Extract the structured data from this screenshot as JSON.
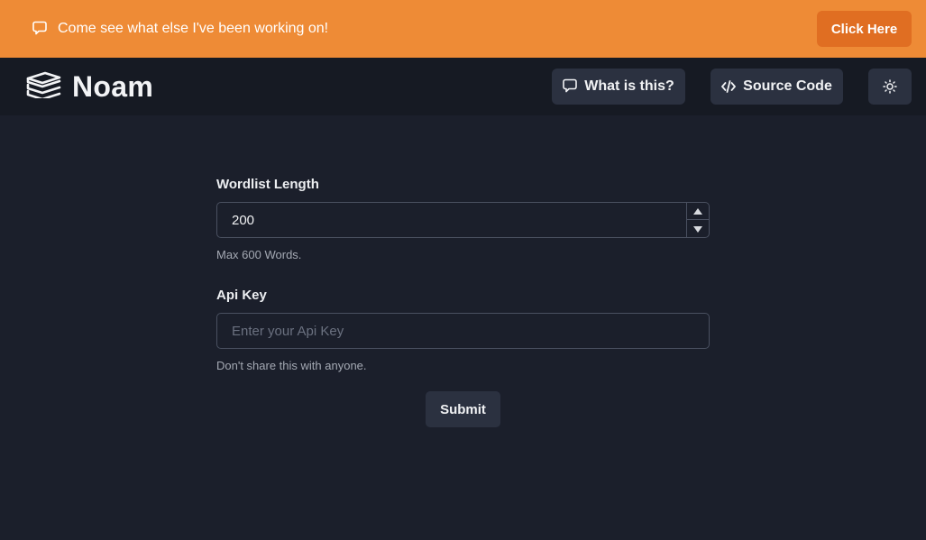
{
  "banner": {
    "message": "Come see what else I've been working on!",
    "button_label": "Click Here",
    "icon": "chat-bubble-icon",
    "background_color": "#ee8b36",
    "button_color": "#e06e22"
  },
  "header": {
    "logo_icon": "books-icon",
    "title": "Noam",
    "buttons": [
      {
        "label": "What is this?",
        "icon": "chat-bubble-icon"
      },
      {
        "label": "Source Code",
        "icon": "code-icon"
      },
      {
        "label": "",
        "icon": "sun-icon"
      }
    ]
  },
  "form": {
    "wordlist": {
      "label": "Wordlist Length",
      "value": "200",
      "hint": "Max 600 Words."
    },
    "api_key": {
      "label": "Api Key",
      "value": "",
      "placeholder": "Enter your Api Key",
      "hint": "Don't share this with anyone."
    },
    "submit_label": "Submit"
  }
}
